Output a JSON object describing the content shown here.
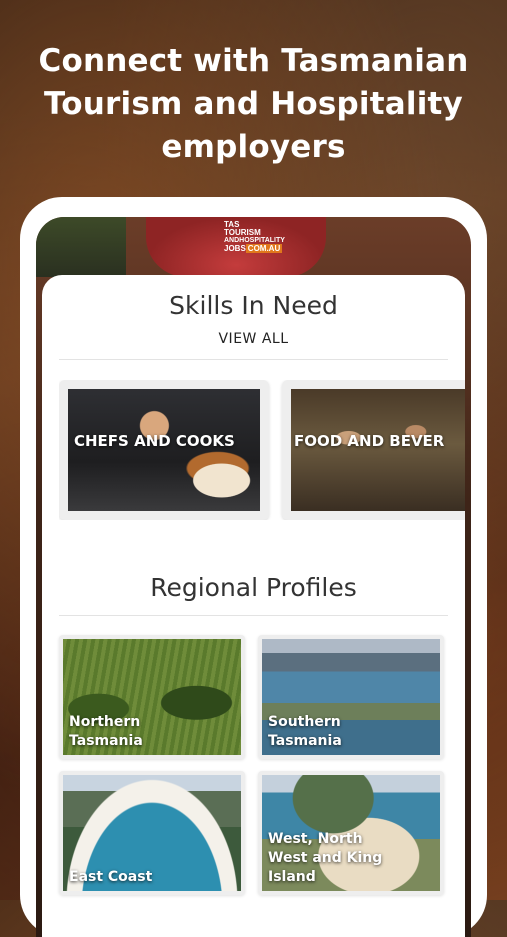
{
  "headline": {
    "line1": "Connect with Tasmanian",
    "line2": "Tourism and Hospitality",
    "line3": "employers"
  },
  "logo": {
    "line1": "TAS",
    "line2": "TOURISM",
    "line3": "ANDHOSPITALITY",
    "line4": "JOBS",
    "badge": "COM.AU"
  },
  "skills": {
    "title": "Skills In Need",
    "view_all": "VIEW ALL",
    "cards": [
      {
        "label": "CHEFS AND COOKS"
      },
      {
        "label": "FOOD AND BEVER"
      }
    ]
  },
  "regions": {
    "title": "Regional Profiles",
    "cards": [
      {
        "label": "Northern\nTasmania"
      },
      {
        "label": "Southern\nTasmania"
      },
      {
        "label": "East Coast"
      },
      {
        "label": "West, North\nWest and King\nIsland"
      }
    ]
  }
}
